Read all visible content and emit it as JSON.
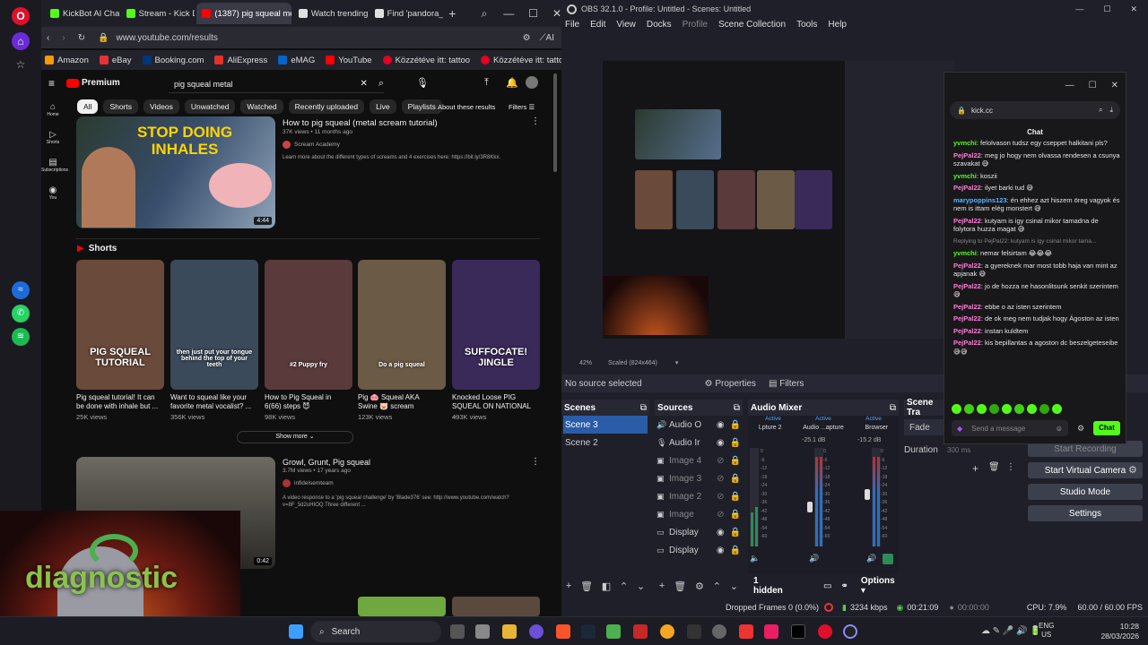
{
  "browser": {
    "tabs": [
      {
        "label": "KickBot AI Chara",
        "color": "#53fc18",
        "active": false
      },
      {
        "label": "Stream - Kick Da",
        "color": "#53fc18",
        "active": false
      },
      {
        "label": "(1387) pig squeal metal",
        "color": "#ff0000",
        "active": true
      },
      {
        "label": "Watch trending",
        "color": "#e0e0e0",
        "active": false
      },
      {
        "label": "Find 'pandora_v",
        "color": "#e0e0e0",
        "active": false
      }
    ],
    "url": "www.youtube.com/results",
    "bookmarks": [
      {
        "label": "Amazon",
        "color": "#ff9900"
      },
      {
        "label": "eBay",
        "color": "#e53238"
      },
      {
        "label": "Booking.com",
        "color": "#003580"
      },
      {
        "label": "AliExpress",
        "color": "#e43225"
      },
      {
        "label": "eMAG",
        "color": "#0066cc"
      },
      {
        "label": "YouTube",
        "color": "#ff0000"
      },
      {
        "label": "Közzétéve itt: tattoo",
        "color": "#e60023"
      },
      {
        "label": "Közzétéve itt: tattoos",
        "color": "#e60023"
      }
    ],
    "ai_label": "AI"
  },
  "youtube": {
    "logo": "Premium",
    "query": "pig squeal metal",
    "nav": [
      "Home",
      "Shorts",
      "Subscriptions",
      "You"
    ],
    "chips": [
      "All",
      "Shorts",
      "Videos",
      "Unwatched",
      "Watched",
      "Recently uploaded",
      "Live",
      "Playlists"
    ],
    "about": "About these results",
    "filters": "Filters",
    "video1": {
      "title": "How to pig squeal (metal scream tutorial)",
      "meta": "37K views • 11 months ago",
      "channel": "Scream Academy",
      "desc": "Learn more about the different types of screams and 4 exercises here: https://bit.ly/3R8Kkx.",
      "duration": "4:44",
      "thumb_text": "STOP DOING INHALES"
    },
    "shorts_label": "Shorts",
    "shorts": [
      {
        "title": "Pig squeal tutorial! It can be done with inhale but ...",
        "views": "25K views",
        "overlay": "PIG SQUEAL TUTORIAL",
        "bg": "#6a4a3a"
      },
      {
        "title": "Want to squeal like your favorite metal vocalist? ...",
        "views": "356K views",
        "overlay": "then just put your tongue behind the top of your teeth",
        "bg": "#3b4a5a"
      },
      {
        "title": "How to Pig Squeal in 6(66) steps 😈",
        "views": "98K views",
        "overlay": "#2 Puppy fry",
        "bg": "#5a3a3a"
      },
      {
        "title": "Pig 🐽 Squeal AKA Swine 🐷 scream",
        "views": "123K views",
        "overlay": "Do a pig squeal",
        "bg": "#6b5a45"
      },
      {
        "title": "Knocked Loose PIG SQUEAL ON NATIONAL ...",
        "views": "493K views",
        "overlay": "SUFFOCATE! JINGLE",
        "bg": "#3a2a5a"
      }
    ],
    "show_more": "Show more",
    "video2": {
      "title": "Growl, Grunt, Pig squeal",
      "meta": "3.7M views • 17 years ago",
      "channel": "infidelsemteam",
      "desc": "A video response to a 'pig squeal challenge' by 'Blade376' see: http://www.youtube.com/watch?v=8F_5d2uHIOQ Three different ...",
      "duration": "0:42"
    }
  },
  "webcam": {
    "overlay": "diagnostic"
  },
  "obs": {
    "title": "OBS 32.1.0 - Profile: Untitled - Scenes: Untitled",
    "menu": [
      "File",
      "Edit",
      "View",
      "Docks",
      "Profile",
      "Scene Collection",
      "Tools",
      "Help"
    ],
    "zoom": "42%",
    "scaled": "Scaled (824x464)",
    "no_source": "No source selected",
    "properties": "Properties",
    "filters": "Filters",
    "scenes_title": "Scenes",
    "scenes": [
      "Scene 3",
      "Scene 2"
    ],
    "sources_title": "Sources",
    "sources": [
      "Audio O",
      "Audio Ir",
      "Image 4",
      "Image 3",
      "Image 2",
      "Image",
      "Display",
      "Display"
    ],
    "mixer_title": "Audio Mixer",
    "mixer": [
      {
        "status": "Active",
        "name": "Ł",
        "device": "Lpture 2",
        "db": ""
      },
      {
        "status": "Active",
        "name": "Audio ...apture",
        "device": "",
        "db": "-25.1 dB"
      },
      {
        "status": "Active",
        "name": "Browser",
        "device": "",
        "db": "-15.2 dB"
      }
    ],
    "mixer_scale": [
      "0",
      "-6",
      "-12",
      "-18",
      "-24",
      "-30",
      "-36",
      "-42",
      "-48",
      "-54",
      "-60"
    ],
    "transitions_title": "Scene Tra",
    "transition": "Fade",
    "duration_label": "Duration",
    "duration_value": "300 ms",
    "controls": [
      "Start Recording",
      "Start Virtual Camera",
      "Studio Mode",
      "Settings"
    ],
    "hidden": "1 hidden",
    "options": "Options",
    "status": {
      "dropped": "Dropped Frames 0 (0.0%)",
      "bitrate": "3234 kbps",
      "live_time": "00:21:09",
      "rec_time": "00:00:00",
      "cpu": "CPU: 7.9%",
      "fps": "60.00 / 60.00 FPS"
    }
  },
  "chat": {
    "address": "kick.cc",
    "title": "Chat",
    "messages": [
      {
        "user": "yvmchi",
        "text": "felolvason tudsz egy cseppet halkitani pls?"
      },
      {
        "user": "PejPal22",
        "text": "meg jo hogy nem olvassa rendesen a csunya szavakat 😅"
      },
      {
        "user": "yvmchi",
        "text": "koszii"
      },
      {
        "user": "PejPal22",
        "text": "ilyet barki tud 😅"
      },
      {
        "user": "marypoppins123",
        "text": "én ehhez azt hiszem öreg vagyok és nem is ittam elég monstert 😅"
      },
      {
        "user": "PejPal22",
        "text": "kutyam is igy csinal mikor tamadna de folytora huzza magat 😅"
      },
      {
        "user": "yvmchi",
        "text": "nemar felsirtam 😂😂😂"
      },
      {
        "user": "PejPal22",
        "text": "a gyereknek mar most tobb haja van mint az apjanak 😅"
      },
      {
        "user": "PejPal22",
        "text": "jo de hozza ne hasonlitsunk senkit szerintem 😅"
      },
      {
        "user": "PejPal22",
        "text": "ebbe o az isten szerintem"
      },
      {
        "user": "PejPal22",
        "text": "de ok meg nem tudjak hogy Ágoston az isten"
      },
      {
        "user": "PejPal22",
        "text": "instan kuldtem"
      },
      {
        "user": "PejPal22",
        "text": "kis bepillantas a agoston dc beszelgeteseibe 😅😅"
      }
    ],
    "reply_hint": "Replying to PejPal22: kutyam is igy csinal mikor tama...",
    "placeholder": "Send a message",
    "send": "Chat"
  },
  "taskbar": {
    "search": "Search",
    "lang": "ENG",
    "region": "US",
    "time": "10:28",
    "date": "28/03/2026"
  }
}
